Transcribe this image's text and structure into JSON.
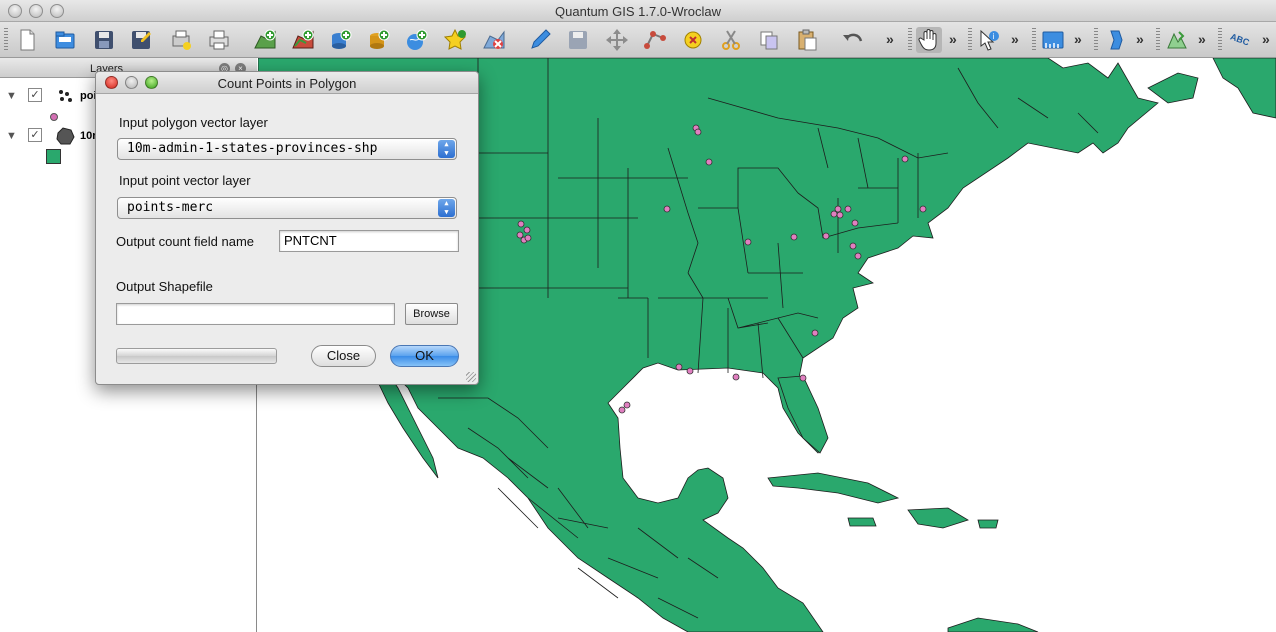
{
  "window": {
    "title": "Quantum GIS 1.7.0-Wroclaw"
  },
  "toolbar": {
    "icons": [
      "new-project-icon",
      "open-project-icon",
      "save-project-icon",
      "save-as-icon",
      "new-print-composer-icon",
      "print-icon",
      "add-vector-layer-icon",
      "add-raster-layer-icon",
      "add-postgis-layer-icon",
      "add-spatialite-layer-icon",
      "add-wms-layer-icon",
      "add-wfs-layer-icon",
      "remove-layer-icon",
      "toggle-editing-icon",
      "save-edits-icon",
      "move-feature-icon",
      "node-tool-icon",
      "delete-selected-icon",
      "cut-features-icon",
      "copy-features-icon",
      "paste-features-icon",
      "undo-icon",
      "pan-map-icon",
      "identify-icon",
      "select-icon",
      "measure-icon",
      "gps-icon",
      "label-icon"
    ],
    "overflow_chevron": "»",
    "label_button_text": "ABC"
  },
  "layers_panel": {
    "title": "Layers",
    "layers": [
      {
        "name": "poi",
        "checked": true,
        "symbol": "point",
        "color": "#d36fb3"
      },
      {
        "name": "10r",
        "checked": true,
        "symbol": "polygon",
        "color": "#2aa86d"
      }
    ]
  },
  "map": {
    "fill_color": "#2aa86d",
    "border_color": "#1d1d1d",
    "point_color": "#e07fc0"
  },
  "dialog": {
    "title": "Count Points in Polygon",
    "polygon_layer_label": "Input polygon vector layer",
    "polygon_layer_value": "10m-admin-1-states-provinces-shp",
    "point_layer_label": "Input point vector layer",
    "point_layer_value": "points-merc",
    "count_field_label": "Output count field name",
    "count_field_value": "PNTCNT",
    "output_shapefile_label": "Output Shapefile",
    "output_shapefile_value": "",
    "browse_label": "Browse",
    "close_label": "Close",
    "ok_label": "OK"
  }
}
